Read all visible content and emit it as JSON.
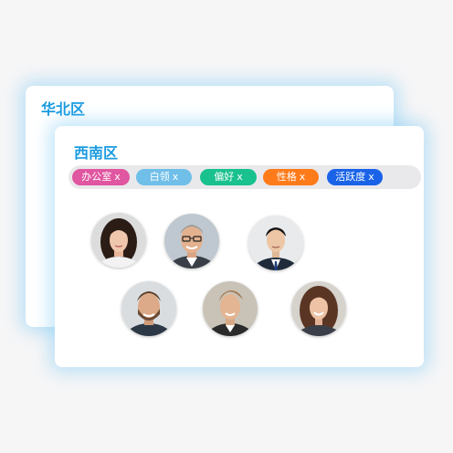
{
  "regions": {
    "back_title": "华北区",
    "front_title": "西南区"
  },
  "tags": [
    {
      "label": "办公室",
      "remove": "x",
      "color": "#e056a0"
    },
    {
      "label": "白领",
      "remove": "x",
      "color": "#6fbfe8"
    },
    {
      "label": "偏好",
      "remove": "x",
      "color": "#19c18e"
    },
    {
      "label": "性格",
      "remove": "x",
      "color": "#ff7b1a"
    },
    {
      "label": "活跃度",
      "remove": "x",
      "color": "#1a63e8"
    }
  ],
  "colors": {
    "accent": "#1a9be0",
    "glow": "#78c8f5",
    "tag_bar": "#e9e9ec"
  },
  "avatars": [
    {
      "icon": "woman-portrait-icon"
    },
    {
      "icon": "man-glasses-portrait-icon"
    },
    {
      "icon": "man-suit-portrait-icon"
    },
    {
      "icon": "man-beard-portrait-icon"
    },
    {
      "icon": "young-man-portrait-icon"
    },
    {
      "icon": "woman-smiling-portrait-icon"
    }
  ]
}
